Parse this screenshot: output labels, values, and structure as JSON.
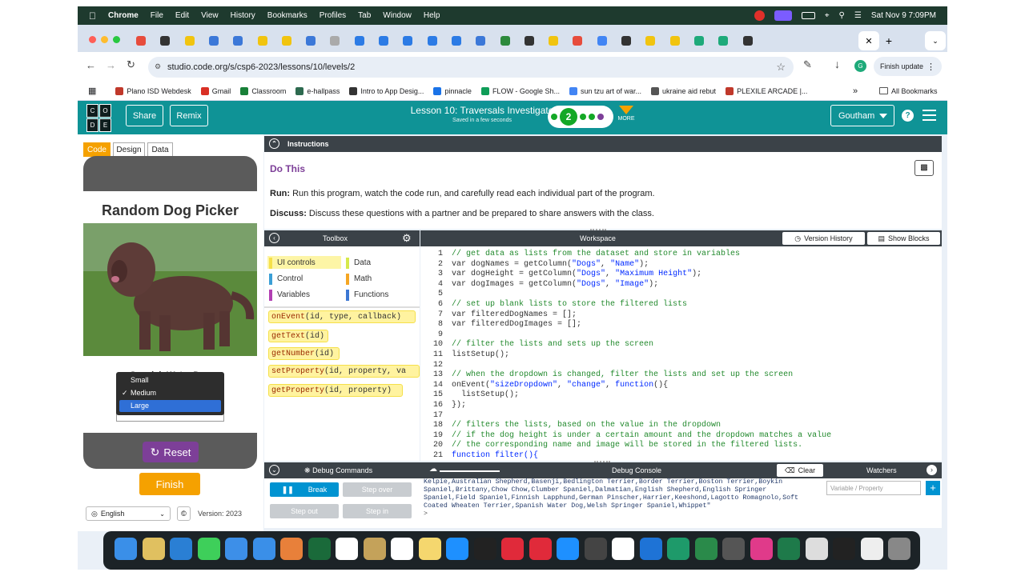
{
  "menubar": {
    "app": "Chrome",
    "items": [
      "File",
      "Edit",
      "View",
      "History",
      "Bookmarks",
      "Profiles",
      "Tab",
      "Window",
      "Help"
    ],
    "clock": "Sat Nov 9  7:09PM"
  },
  "browser": {
    "url": "studio.code.org/s/csp6-2023/lessons/10/levels/2",
    "finish_update": "Finish update",
    "bookmarks": [
      {
        "label": "Plano ISD Webdesk",
        "color": "#c0392b"
      },
      {
        "label": "Gmail",
        "color": "#d93025"
      },
      {
        "label": "Classroom",
        "color": "#188038"
      },
      {
        "label": "e-hallpass",
        "color": "#2d6a4f"
      },
      {
        "label": "Intro to App Desig...",
        "color": "#333333"
      },
      {
        "label": "pinnacle",
        "color": "#1a73e8"
      },
      {
        "label": "FLOW - Google Sh...",
        "color": "#0f9d58"
      },
      {
        "label": "sun tzu art of war...",
        "color": "#4285f4"
      },
      {
        "label": "ukraine aid rebut",
        "color": "#555555"
      },
      {
        "label": "PLEXILE ARCADE |...",
        "color": "#c0392b"
      }
    ],
    "all_bookmarks": "All Bookmarks"
  },
  "header": {
    "share": "Share",
    "remix": "Remix",
    "lesson_title": "Lesson 10: Traversals Investigate",
    "saved": "Saved in a few seconds",
    "current_level": "2",
    "more": "MORE",
    "user": "Goutham"
  },
  "left": {
    "tabs": [
      "Code",
      "Design",
      "Data"
    ],
    "app_title": "Random Dog Picker",
    "dog_name": "Spanish Water Dog",
    "dropdown_options": [
      "Small",
      "Medium",
      "Large"
    ],
    "dropdown_checked": "Medium",
    "dropdown_highlighted": "Large",
    "reset": "Reset",
    "finish": "Finish",
    "language": "English",
    "version": "Version: 2023"
  },
  "instructions": {
    "header": "Instructions",
    "title": "Do This",
    "run_label": "Run:",
    "run_text": " Run this program, watch the code run, and carefully read each individual part of the program.",
    "discuss_label": "Discuss:",
    "discuss_text": " Discuss these questions with a partner and be prepared to share answers with the class."
  },
  "toolbox": {
    "title": "Toolbox",
    "categories": [
      {
        "label": "UI controls",
        "color": "#f5e04a"
      },
      {
        "label": "Data",
        "color": "#d6e94b"
      },
      {
        "label": "Control",
        "color": "#3b9fd6"
      },
      {
        "label": "Math",
        "color": "#f5a623"
      },
      {
        "label": "Variables",
        "color": "#b23fb3"
      },
      {
        "label": "Functions",
        "color": "#3c77d3"
      }
    ],
    "blocks": [
      {
        "name": "onEvent",
        "args": "(id, type, callback)"
      },
      {
        "name": "getText",
        "args": "(id)"
      },
      {
        "name": "getNumber",
        "args": "(id)"
      },
      {
        "name": "setProperty",
        "args": "(id, property, va"
      },
      {
        "name": "getProperty",
        "args": "(id, property)"
      }
    ]
  },
  "workspace": {
    "title": "Workspace",
    "version_history": "Version History",
    "show_blocks": "Show Blocks",
    "lines": [
      [
        {
          "t": "// get data as lists from the dataset and store in variables",
          "c": "cm"
        }
      ],
      [
        {
          "t": "var dogNames = getColumn(",
          "c": "kw"
        },
        {
          "t": "\"Dogs\"",
          "c": "st"
        },
        {
          "t": ", ",
          "c": "kw"
        },
        {
          "t": "\"Name\"",
          "c": "st"
        },
        {
          "t": ");",
          "c": "kw"
        }
      ],
      [
        {
          "t": "var dogHeight = getColumn(",
          "c": "kw"
        },
        {
          "t": "\"Dogs\"",
          "c": "st"
        },
        {
          "t": ", ",
          "c": "kw"
        },
        {
          "t": "\"Maximum Height\"",
          "c": "st"
        },
        {
          "t": ");",
          "c": "kw"
        }
      ],
      [
        {
          "t": "var dogImages = getColumn(",
          "c": "kw"
        },
        {
          "t": "\"Dogs\"",
          "c": "st"
        },
        {
          "t": ", ",
          "c": "kw"
        },
        {
          "t": "\"Image\"",
          "c": "st"
        },
        {
          "t": ");",
          "c": "kw"
        }
      ],
      [],
      [
        {
          "t": "// set up blank lists to store the filtered lists",
          "c": "cm"
        }
      ],
      [
        {
          "t": "var filteredDogNames = [];",
          "c": "kw"
        }
      ],
      [
        {
          "t": "var filteredDogImages = [];",
          "c": "kw"
        }
      ],
      [],
      [
        {
          "t": "// filter the lists and sets up the screen",
          "c": "cm"
        }
      ],
      [
        {
          "t": "listSetup();",
          "c": "kw"
        }
      ],
      [],
      [
        {
          "t": "// when the dropdown is changed, filter the lists and set up the screen",
          "c": "cm"
        }
      ],
      [
        {
          "t": "onEvent(",
          "c": "kw"
        },
        {
          "t": "\"sizeDropdown\"",
          "c": "st"
        },
        {
          "t": ", ",
          "c": "kw"
        },
        {
          "t": "\"change\"",
          "c": "st"
        },
        {
          "t": ", ",
          "c": "kw"
        },
        {
          "t": "function",
          "c": "st"
        },
        {
          "t": "(){",
          "c": "kw"
        }
      ],
      [
        {
          "t": "  listSetup();",
          "c": "kw"
        }
      ],
      [
        {
          "t": "});",
          "c": "kw"
        }
      ],
      [],
      [
        {
          "t": "// filters the lists, based on the value in the dropdown",
          "c": "cm"
        }
      ],
      [
        {
          "t": "// if the dog height is under a certain amount and the dropdown matches a value",
          "c": "cm"
        }
      ],
      [
        {
          "t": "// the corresponding name and image will be stored in the filtered lists.",
          "c": "cm"
        }
      ],
      [
        {
          "t": "function filter(){",
          "c": "st"
        }
      ]
    ]
  },
  "debug": {
    "commands": "Debug Commands",
    "console_title": "Debug Console",
    "clear": "Clear",
    "watchers": "Watchers",
    "break": "Break",
    "step_over": "Step over",
    "step_out": "Step out",
    "step_in": "Step in",
    "watch_placeholder": "Variable / Property",
    "console_text": "Kelpie,Australian Shepherd,Basenji,Bedlington Terrier,Border Terrier,Boston Terrier,Boykin Spaniel,Brittany,Chow Chow,Clumber Spaniel,Dalmatian,English Shepherd,English Springer Spaniel,Field Spaniel,Finnish Lapphund,German Pinscher,Harrier,Keeshond,Lagotto Romagnolo,Soft Coated Wheaten Terrier,Spanish Water Dog,Welsh Springer Spaniel,Whippet\"",
    "prompt": ">"
  }
}
